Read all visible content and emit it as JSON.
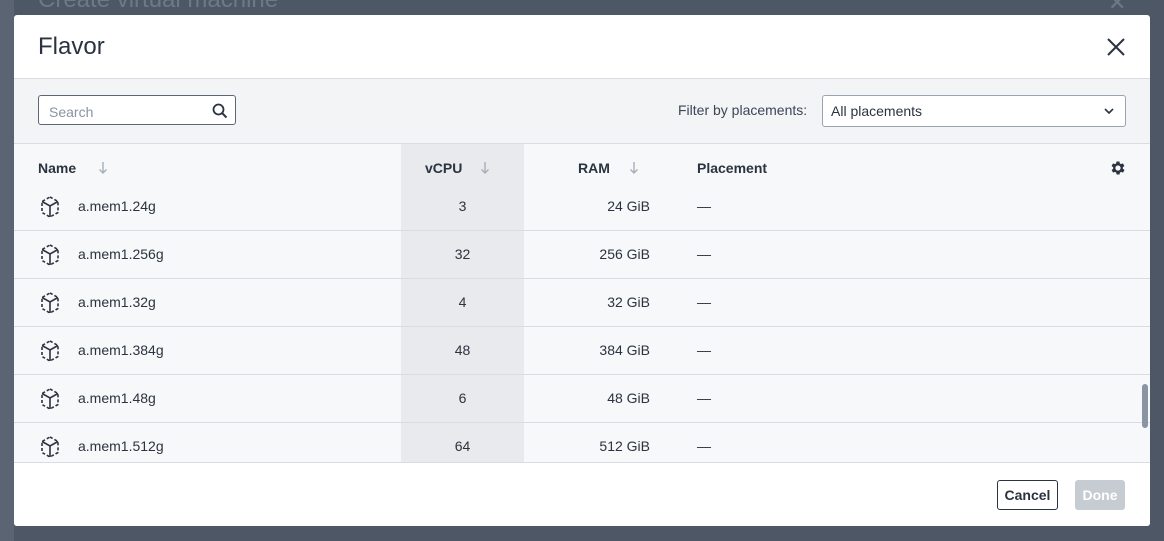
{
  "background": {
    "title": "Create virtual machine"
  },
  "modal": {
    "title": "Flavor"
  },
  "toolbar": {
    "search_placeholder": "Search",
    "filter_label": "Filter by placements:",
    "filter_value": "All placements"
  },
  "table": {
    "columns": {
      "name": "Name",
      "vcpu": "vCPU",
      "ram": "RAM",
      "placement": "Placement"
    },
    "rows": [
      {
        "name": "a.mem1.24g",
        "vcpu": "3",
        "ram": "24 GiB",
        "placement": "—"
      },
      {
        "name": "a.mem1.256g",
        "vcpu": "32",
        "ram": "256 GiB",
        "placement": "—"
      },
      {
        "name": "a.mem1.32g",
        "vcpu": "4",
        "ram": "32 GiB",
        "placement": "—"
      },
      {
        "name": "a.mem1.384g",
        "vcpu": "48",
        "ram": "384 GiB",
        "placement": "—"
      },
      {
        "name": "a.mem1.48g",
        "vcpu": "6",
        "ram": "48 GiB",
        "placement": "—"
      },
      {
        "name": "a.mem1.512g",
        "vcpu": "64",
        "ram": "512 GiB",
        "placement": "—"
      }
    ]
  },
  "footer": {
    "cancel_label": "Cancel",
    "done_label": "Done"
  },
  "colors": {
    "text": "#2b3340",
    "disabled_button": "#c7ccd3",
    "header_bg": "#f3f4f6"
  },
  "icons": {
    "close": "close-icon",
    "search": "search-icon",
    "select": "chevron-down-icon",
    "sort": "arrow-down-icon",
    "settings": "gear-icon",
    "flavor": "cube-icon"
  }
}
